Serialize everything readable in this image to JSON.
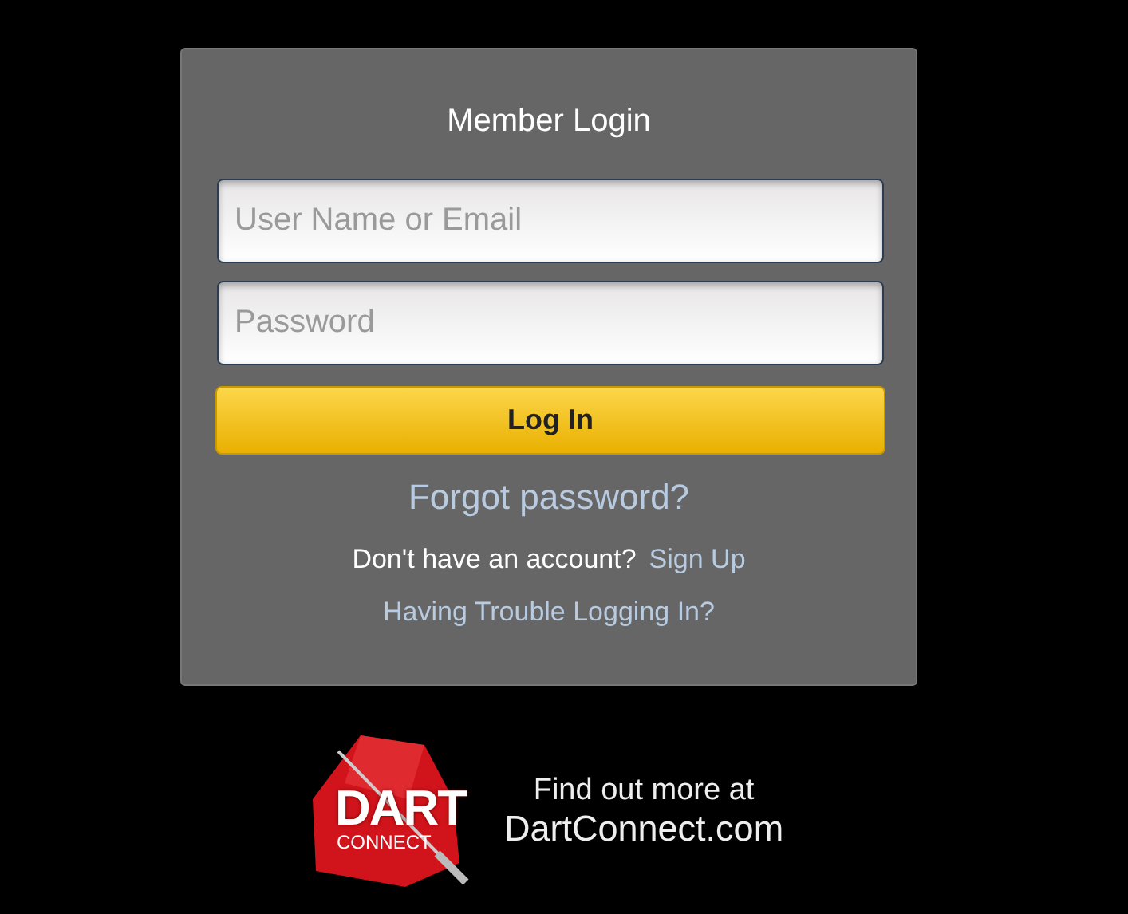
{
  "login": {
    "title": "Member Login",
    "fields": [
      {
        "placeholder": "User Name or Email"
      },
      {
        "placeholder": "Password"
      }
    ],
    "button": "Log In",
    "forgot": "Forgot password?",
    "signup_prompt": "Don't have an account?",
    "signup_link": "Sign Up",
    "trouble": "Having Trouble Logging In?"
  },
  "promo": {
    "logo": {
      "line_1": "DART",
      "line_2": "CONNECT"
    },
    "line_1": "Find out more at",
    "line_2": "DartConnect.com"
  }
}
